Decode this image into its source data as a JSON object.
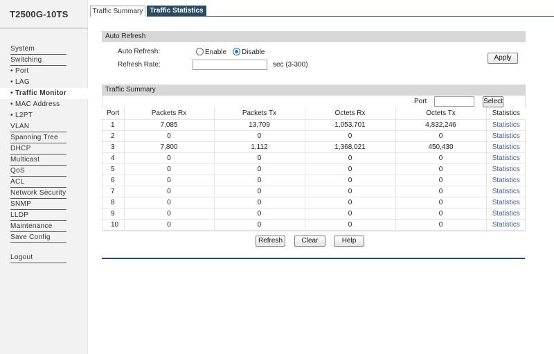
{
  "brand": "T2500G-10TS",
  "sidebar": {
    "items": [
      {
        "label": "System",
        "type": "main"
      },
      {
        "label": "Switching",
        "type": "main"
      },
      {
        "label": "Port",
        "type": "sub"
      },
      {
        "label": "LAG",
        "type": "sub"
      },
      {
        "label": "Traffic Monitor",
        "type": "sub",
        "active": true
      },
      {
        "label": "MAC Address",
        "type": "sub"
      },
      {
        "label": "L2PT",
        "type": "sub"
      },
      {
        "label": "VLAN",
        "type": "main"
      },
      {
        "label": "Spanning Tree",
        "type": "main"
      },
      {
        "label": "DHCP",
        "type": "main"
      },
      {
        "label": "Multicast",
        "type": "main"
      },
      {
        "label": "QoS",
        "type": "main"
      },
      {
        "label": "ACL",
        "type": "main"
      },
      {
        "label": "Network Security",
        "type": "main"
      },
      {
        "label": "SNMP",
        "type": "main"
      },
      {
        "label": "LLDP",
        "type": "main"
      },
      {
        "label": "Maintenance",
        "type": "main"
      },
      {
        "label": "Save Config",
        "type": "main"
      }
    ],
    "logout": "Logout"
  },
  "tabs": {
    "summary": "Traffic Summary",
    "statistics": "Traffic Statistics"
  },
  "auto_refresh": {
    "title": "Auto Refresh",
    "auto_refresh_label": "Auto Refresh:",
    "enable": "Enable",
    "disable": "Disable",
    "selected": "Disable",
    "rate_label": "Refresh Rate:",
    "rate_value": "",
    "rate_hint": "sec (3-300)",
    "apply": "Apply"
  },
  "summary": {
    "title": "Traffic Summary",
    "port_label": "Port",
    "port_value": "",
    "select": "Select",
    "columns": [
      "Port",
      "Packets Rx",
      "Packets Tx",
      "Octets Rx",
      "Octets Tx",
      "Statistics"
    ],
    "rows": [
      [
        "1",
        "7,085",
        "13,709",
        "1,053,701",
        "4,832,246",
        "Statistics"
      ],
      [
        "2",
        "0",
        "0",
        "0",
        "0",
        "Statistics"
      ],
      [
        "3",
        "7,800",
        "1,112",
        "1,368,021",
        "450,430",
        "Statistics"
      ],
      [
        "4",
        "0",
        "0",
        "0",
        "0",
        "Statistics"
      ],
      [
        "5",
        "0",
        "0",
        "0",
        "0",
        "Statistics"
      ],
      [
        "6",
        "0",
        "0",
        "0",
        "0",
        "Statistics"
      ],
      [
        "7",
        "0",
        "0",
        "0",
        "0",
        "Statistics"
      ],
      [
        "8",
        "0",
        "0",
        "0",
        "0",
        "Statistics"
      ],
      [
        "9",
        "0",
        "0",
        "0",
        "0",
        "Statistics"
      ],
      [
        "10",
        "0",
        "0",
        "0",
        "0",
        "Statistics"
      ]
    ]
  },
  "buttons": {
    "refresh": "Refresh",
    "clear": "Clear",
    "help": "Help"
  }
}
